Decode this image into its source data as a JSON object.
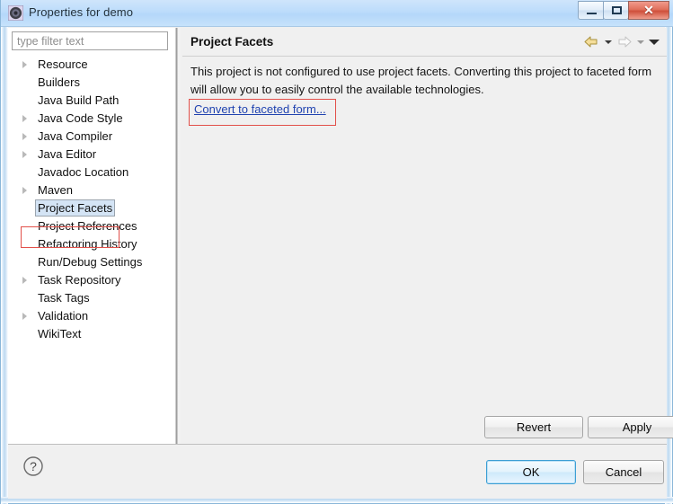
{
  "window": {
    "title": "Properties for demo",
    "icon": "eclipse-properties-icon",
    "controls": {
      "minimize_label": "Minimize",
      "maximize_label": "Maximize",
      "close_label": "✕"
    }
  },
  "sidebar": {
    "filter": {
      "placeholder": "type filter text",
      "value": ""
    },
    "items": [
      {
        "label": "Resource",
        "expandable": true,
        "selected": false
      },
      {
        "label": "Builders",
        "expandable": false,
        "selected": false
      },
      {
        "label": "Java Build Path",
        "expandable": false,
        "selected": false
      },
      {
        "label": "Java Code Style",
        "expandable": true,
        "selected": false
      },
      {
        "label": "Java Compiler",
        "expandable": true,
        "selected": false
      },
      {
        "label": "Java Editor",
        "expandable": true,
        "selected": false
      },
      {
        "label": "Javadoc Location",
        "expandable": false,
        "selected": false
      },
      {
        "label": "Maven",
        "expandable": true,
        "selected": false
      },
      {
        "label": "Project Facets",
        "expandable": false,
        "selected": true
      },
      {
        "label": "Project References",
        "expandable": false,
        "selected": false
      },
      {
        "label": "Refactoring History",
        "expandable": false,
        "selected": false
      },
      {
        "label": "Run/Debug Settings",
        "expandable": false,
        "selected": false
      },
      {
        "label": "Task Repository",
        "expandable": true,
        "selected": false
      },
      {
        "label": "Task Tags",
        "expandable": false,
        "selected": false
      },
      {
        "label": "Validation",
        "expandable": true,
        "selected": false
      },
      {
        "label": "WikiText",
        "expandable": false,
        "selected": false
      }
    ]
  },
  "content": {
    "title": "Project Facets",
    "description": "This project is not configured to use project facets. Converting this project to faceted form will allow you to easily control the available technologies.",
    "link_label": "Convert to faceted form...",
    "nav": {
      "back_icon": "back-arrow-icon",
      "back_menu_icon": "chevron-down-icon",
      "forward_icon": "forward-arrow-icon",
      "forward_menu_icon": "chevron-down-icon",
      "view_menu_icon": "chevron-down-icon"
    },
    "buttons": {
      "revert": "Revert",
      "apply": "Apply"
    }
  },
  "footer": {
    "help_icon": "help-question-icon",
    "ok": "OK",
    "cancel": "Cancel"
  },
  "colors": {
    "titlebar": "#bcdcfb",
    "panel_bg": "#f0f0f0",
    "tree_bg": "#ffffff",
    "link": "#2043b0",
    "annotation": "#e2504a",
    "selection": "#d4e4f5",
    "ok_focus_border": "#3c9fd4"
  }
}
